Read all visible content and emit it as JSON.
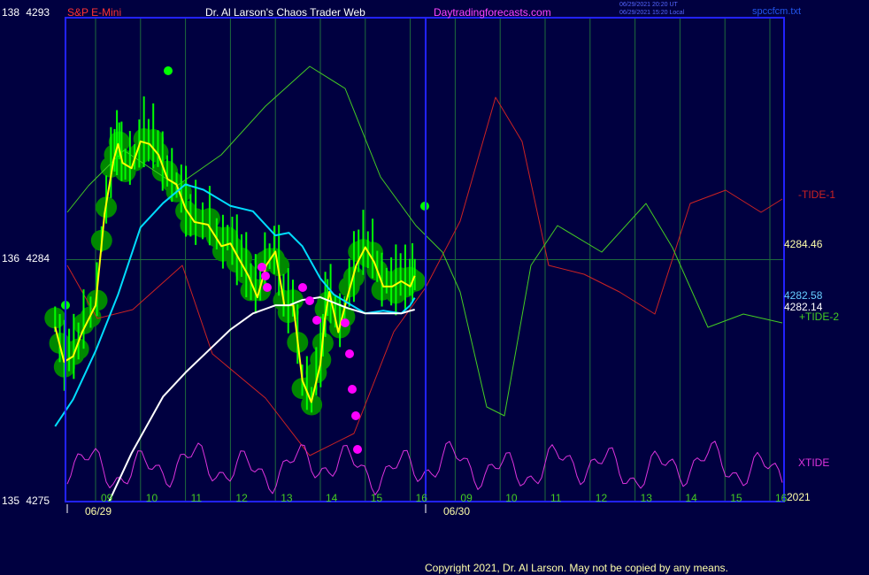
{
  "header": {
    "symbol": "S&P E-Mini",
    "title": "Dr. Al Larson's Chaos Trader Web",
    "site": "Daytradingforecasts.com",
    "stamp_utc": "06/29/2021 20:20 UT",
    "stamp_local": "06/29/2021 15:20 Local",
    "file": "spccfcm.txt"
  },
  "copyright": "Copyright 2021, Dr. Al Larson. May not be copied by any means.",
  "colors": {
    "background": "#000040",
    "frame": "#2222ff",
    "grid": "#1e6b3c",
    "price_bars": "#00ff00",
    "halo": "#008800",
    "yellow_ma": "#ffff00",
    "cyan_ma": "#00ddff",
    "white_ma": "#ffffff",
    "tide1": "#cc2222",
    "tide2": "#44cc22",
    "xtide": "#dd33dd",
    "magenta_dots": "#ff00ff",
    "text_red": "#ff3333",
    "text_white": "#ffffff",
    "text_magenta": "#ff44ff",
    "text_yellow": "#ffffaa"
  },
  "chart_data": {
    "type": "line",
    "title": "S&P E-Mini",
    "time_axis": {
      "day1": "06/29",
      "day2": "06/30",
      "day1_hours": [
        "09",
        "10",
        "11",
        "12",
        "13",
        "14",
        "15",
        "16"
      ],
      "day2_hours": [
        "09",
        "10",
        "11",
        "12",
        "13",
        "14",
        "15",
        "16"
      ],
      "year_label": "2021"
    },
    "y_axis": {
      "ticks": [
        {
          "left": "138",
          "right": "4293",
          "price": 4293
        },
        {
          "left": "136",
          "right": "4284",
          "price": 4284
        },
        {
          "left": "135",
          "right": "4275",
          "price": 4275
        }
      ],
      "ylim": [
        4275,
        4293
      ]
    },
    "price_labels": [
      {
        "text": "4284.46",
        "price": 4284.46,
        "color": "#ffffaa"
      },
      {
        "text": "4282.58",
        "price": 4282.58,
        "color": "#66ccff"
      },
      {
        "text": "4282.14",
        "price": 4282.14,
        "color": "#ffffff"
      }
    ],
    "series_labels": {
      "tide1": "-TIDE-1",
      "tide2": "+TIDE-2",
      "xtide": "XTIDE"
    },
    "hours_x": [
      0,
      1,
      2,
      3,
      4,
      5,
      6,
      7,
      8,
      9,
      10,
      11,
      12,
      13,
      14,
      15,
      16
    ],
    "price_hours": [
      -0.9,
      -0.7,
      -0.5,
      -0.3,
      0,
      0.2,
      0.4,
      0.5,
      0.6,
      0.8,
      1.0,
      1.2,
      1.4,
      1.6,
      1.8,
      2.0,
      2.2,
      2.5,
      2.8,
      3.0,
      3.2,
      3.4,
      3.6,
      3.8,
      4.0,
      4.2,
      4.4,
      4.6,
      4.8,
      5.0,
      5.1,
      5.2,
      5.4,
      5.6,
      5.8,
      6.0,
      6.2,
      6.4,
      6.6,
      6.8,
      7.0,
      7.1
    ],
    "price": [
      4281.5,
      4280.2,
      4280.4,
      4281.3,
      4282.3,
      4285.7,
      4287.7,
      4288.3,
      4287.6,
      4287.4,
      4288.4,
      4288.3,
      4287.9,
      4287.0,
      4286.8,
      4285.9,
      4285.4,
      4285.3,
      4284.5,
      4284.6,
      4284.0,
      4283.4,
      4282.6,
      4283.8,
      4284.3,
      4282.3,
      4282.3,
      4279.5,
      4278.7,
      4280.1,
      4281.8,
      4282.8,
      4281.3,
      4282.6,
      4283.8,
      4284.46,
      4283.9,
      4283.0,
      4283.0,
      4283.2,
      4283.0,
      4283.4
    ],
    "cyan_hours": [
      -0.9,
      -0.5,
      0,
      0.5,
      1.0,
      1.5,
      2.0,
      2.4,
      3.0,
      3.5,
      4.0,
      4.3,
      4.6,
      5.0,
      5.3,
      5.6,
      6.0,
      6.4,
      6.8,
      7.0,
      7.1
    ],
    "cyan_ma": [
      4277.8,
      4278.8,
      4280.6,
      4282.7,
      4285.2,
      4286.1,
      4286.8,
      4286.6,
      4286.0,
      4285.8,
      4284.9,
      4285.0,
      4284.5,
      4283.3,
      4282.7,
      4282.4,
      4282.0,
      4282.1,
      4282.0,
      4282.3,
      4282.58
    ],
    "white_hours": [
      0.3,
      0.8,
      1.5,
      2.0,
      2.5,
      3.0,
      3.5,
      4.0,
      4.3,
      4.6,
      5.0,
      5.3,
      5.6,
      6.0,
      6.4,
      6.8,
      7.0,
      7.1
    ],
    "white_ma": [
      4275.0,
      4276.8,
      4278.9,
      4279.8,
      4280.6,
      4281.4,
      4282.0,
      4282.3,
      4282.3,
      4282.5,
      4282.6,
      4282.4,
      4282.2,
      4282.0,
      4282.0,
      4282.0,
      4282.1,
      4282.14
    ]
  }
}
